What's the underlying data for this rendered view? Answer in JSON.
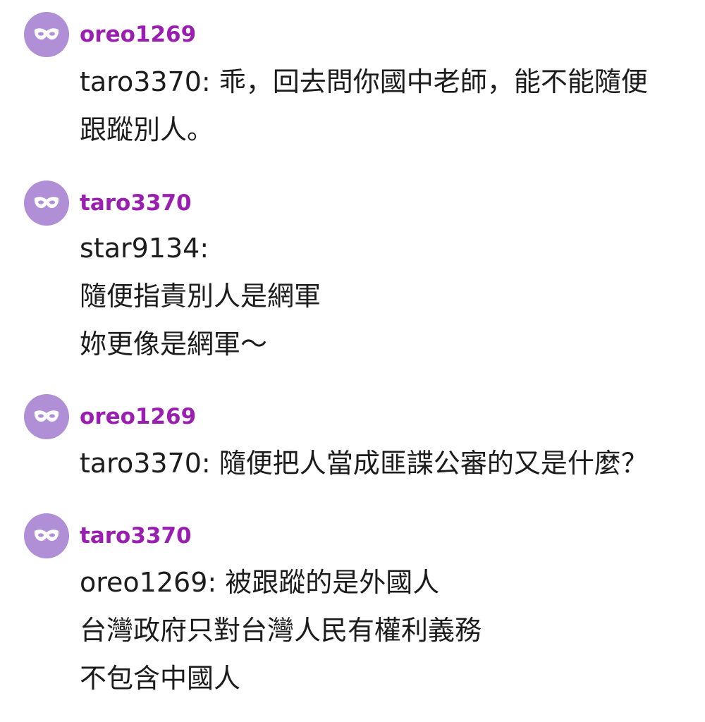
{
  "colors": {
    "avatar_bg": "#b18fd6",
    "username": "#9a1fb0",
    "text": "#1c1c1c",
    "background": "#ffffff"
  },
  "avatar_icon": "mask-icon",
  "comments": [
    {
      "username": "oreo1269",
      "lines": [
        "taro3370: 乖，回去問你國中老師，能不能隨便",
        "跟蹤別人。"
      ]
    },
    {
      "username": "taro3370",
      "lines": [
        "star9134:",
        "隨便指責別人是網軍",
        "妳更像是網軍～"
      ]
    },
    {
      "username": "oreo1269",
      "lines": [
        "taro3370: 隨便把人當成匪諜公審的又是什麼？"
      ]
    },
    {
      "username": "taro3370",
      "lines": [
        "oreo1269: 被跟蹤的是外國人",
        "台灣政府只對台灣人民有權利義務",
        "不包含中國人"
      ]
    }
  ]
}
